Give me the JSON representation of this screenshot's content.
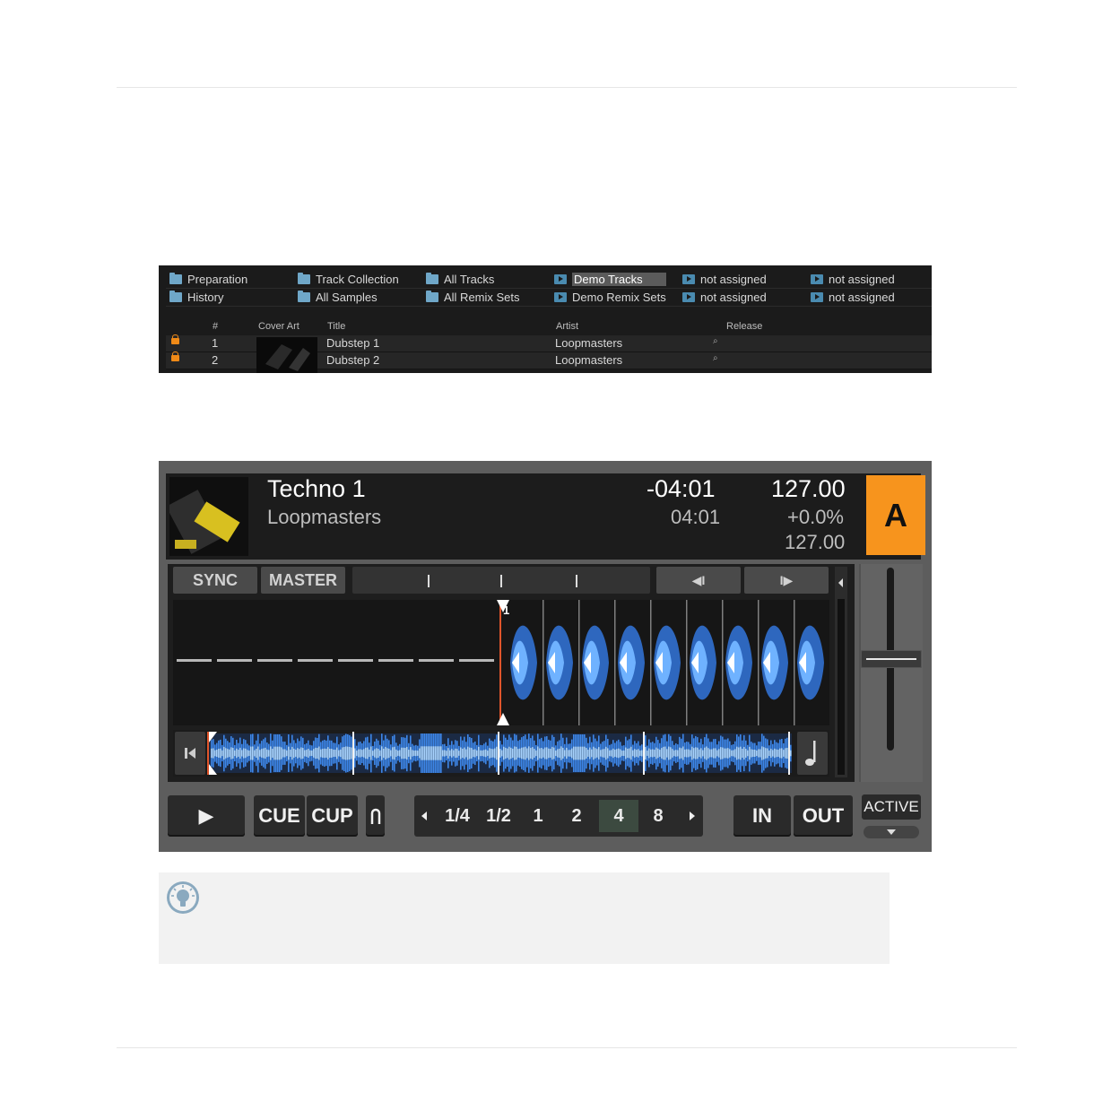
{
  "browser": {
    "favorites": [
      {
        "label": "Preparation",
        "icon": "folder-home-icon",
        "type": "folder"
      },
      {
        "label": "Track Collection",
        "icon": "collection-icon",
        "type": "folder"
      },
      {
        "label": "All Tracks",
        "icon": "folder-icon",
        "type": "folder"
      },
      {
        "label": "Demo Tracks",
        "icon": "playlist-icon",
        "type": "play",
        "selected": true
      },
      {
        "label": "not assigned",
        "icon": "playlist-icon",
        "type": "play"
      },
      {
        "label": "not assigned",
        "icon": "playlist-icon",
        "type": "play"
      },
      {
        "label": "History",
        "icon": "folder-icon",
        "type": "folder"
      },
      {
        "label": "All Samples",
        "icon": "folder-icon",
        "type": "folder"
      },
      {
        "label": "All Remix Sets",
        "icon": "remix-set-icon",
        "type": "folder"
      },
      {
        "label": "Demo Remix Sets",
        "icon": "playlist-icon",
        "type": "play"
      },
      {
        "label": "not assigned",
        "icon": "playlist-icon",
        "type": "play"
      },
      {
        "label": "not assigned",
        "icon": "playlist-icon",
        "type": "play"
      }
    ],
    "columns": {
      "num": "#",
      "cover": "Cover Art",
      "title": "Title",
      "artist": "Artist",
      "release": "Release"
    },
    "rows": [
      {
        "num": "1",
        "title": "Dubstep 1",
        "artist": "Loopmasters"
      },
      {
        "num": "2",
        "title": "Dubstep 2",
        "artist": "Loopmasters"
      }
    ],
    "search_glyph": "⌕"
  },
  "deck": {
    "title": "Techno 1",
    "artist": "Loopmasters",
    "time_remaining": "-04:01",
    "time_total": "04:01",
    "bpm": "127.00",
    "tempo_offset": "+0.0%",
    "bpm_original": "127.00",
    "letter": "A",
    "accent_color": "#f7941d",
    "sync_label": "SYNC",
    "master_label": "MASTER",
    "beat_back_glyph": "◀I",
    "beat_fwd_glyph": "I▶",
    "cue_marker_num": "1",
    "play_glyph": "▶",
    "cue_label": "CUE",
    "cup_label": "CUP",
    "loop_sizes": [
      "1/4",
      "1/2",
      "1",
      "2",
      "4",
      "8"
    ],
    "loop_selected": "4",
    "in_label": "IN",
    "out_label": "OUT",
    "active_label": "ACTIVE",
    "waveform_color": "#3a7fe0"
  }
}
